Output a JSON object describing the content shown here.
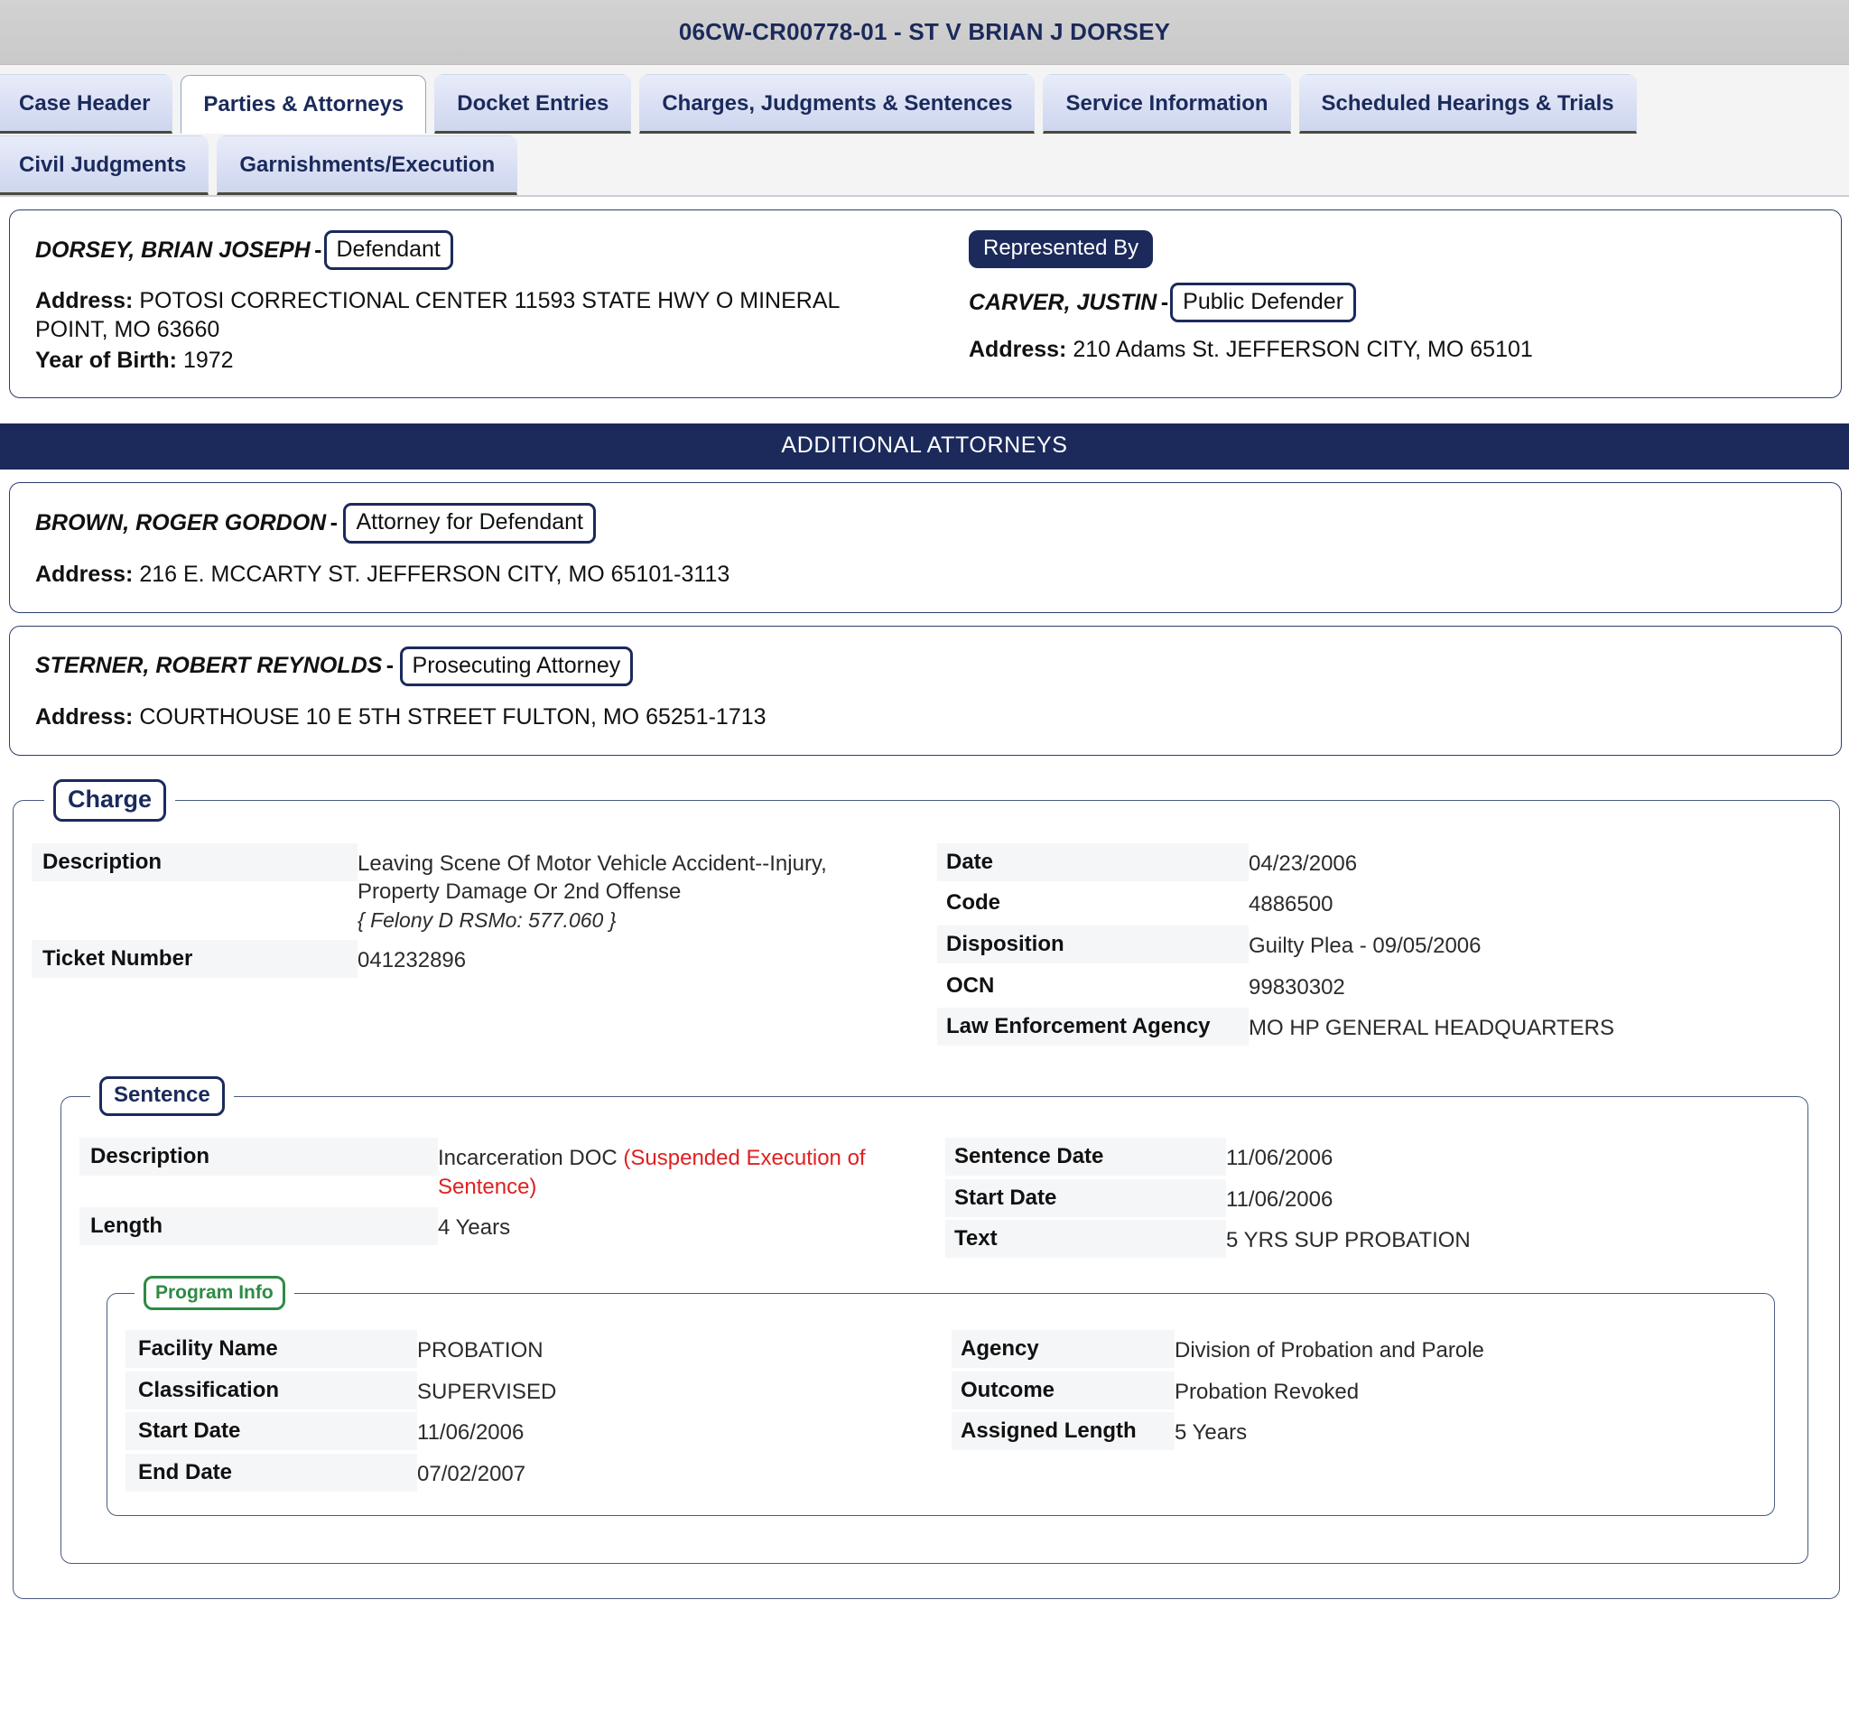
{
  "window": {
    "title": "06CW-CR00778-01 - ST V BRIAN J DORSEY"
  },
  "tabs": {
    "row1": [
      {
        "label": "Case Header",
        "active": false
      },
      {
        "label": "Parties & Attorneys",
        "active": true
      },
      {
        "label": "Docket Entries",
        "active": false
      },
      {
        "label": "Charges, Judgments & Sentences",
        "active": false
      },
      {
        "label": "Service Information",
        "active": false
      },
      {
        "label": "Scheduled Hearings & Trials",
        "active": false
      }
    ],
    "row2": [
      {
        "label": "Civil Judgments",
        "active": false
      },
      {
        "label": "Garnishments/Execution",
        "active": false
      }
    ]
  },
  "defendant": {
    "name": "DORSEY, BRIAN JOSEPH",
    "separator": "-",
    "role": "Defendant",
    "address_label": "Address:",
    "address": "POTOSI CORRECTIONAL CENTER 11593 STATE HWY O MINERAL POINT, MO 63660",
    "yob_label": "Year of Birth:",
    "yob": "1972"
  },
  "represented_by": {
    "badge": "Represented By",
    "name": "CARVER, JUSTIN",
    "separator": "-",
    "role": "Public Defender",
    "address_label": "Address:",
    "address": "210 Adams St. JEFFERSON CITY, MO 65101"
  },
  "additional_attorneys": {
    "banner": "ADDITIONAL ATTORNEYS",
    "entries": [
      {
        "name": "BROWN, ROGER GORDON",
        "separator": "-",
        "role": "Attorney for Defendant",
        "address_label": "Address:",
        "address": "216 E. MCCARTY ST. JEFFERSON CITY, MO 65101-3113"
      },
      {
        "name": "STERNER, ROBERT REYNOLDS",
        "separator": "-",
        "role": "Prosecuting Attorney",
        "address_label": "Address:",
        "address": "COURTHOUSE 10 E 5TH STREET FULTON, MO 65251-1713"
      }
    ]
  },
  "charge": {
    "legend": "Charge",
    "left": [
      {
        "label": "Description",
        "value": "Leaving Scene Of Motor Vehicle Accident--Injury, Property Damage Or 2nd Offense",
        "statute": "{ Felony D RSMo: 577.060 }"
      },
      {
        "label": "Ticket Number",
        "value": "041232896"
      }
    ],
    "right": [
      {
        "label": "Date",
        "value": "04/23/2006"
      },
      {
        "label": "Code",
        "value": "4886500"
      },
      {
        "label": "Disposition",
        "value": "Guilty Plea - 09/05/2006"
      },
      {
        "label": "OCN",
        "value": "99830302"
      },
      {
        "label": "Law Enforcement Agency",
        "value": "MO HP GENERAL HEADQUARTERS"
      }
    ]
  },
  "sentence": {
    "legend": "Sentence",
    "description_label": "Description",
    "description_main": "Incarceration DOC ",
    "description_red": "(Suspended Execution of Sentence)",
    "left": [
      {
        "label": "Length",
        "value": "4 Years"
      }
    ],
    "right": [
      {
        "label": "Sentence Date",
        "value": "11/06/2006"
      },
      {
        "label": "Start Date",
        "value": "11/06/2006"
      },
      {
        "label": "Text",
        "value": "5 YRS SUP PROBATION"
      }
    ]
  },
  "program_info": {
    "legend": "Program Info",
    "left": [
      {
        "label": "Facility Name",
        "value": "PROBATION"
      },
      {
        "label": "Classification",
        "value": "SUPERVISED"
      },
      {
        "label": "Start Date",
        "value": "11/06/2006"
      },
      {
        "label": "End Date",
        "value": "07/02/2007"
      }
    ],
    "right": [
      {
        "label": "Agency",
        "value": "Division of Probation and Parole"
      },
      {
        "label": "Outcome",
        "value": "Probation Revoked"
      },
      {
        "label": "Assigned Length",
        "value": "5 Years"
      }
    ]
  },
  "colors": {
    "navy": "#1b2a5b",
    "banner_bg": "#1b2a5b",
    "green": "#2e8b45",
    "red": "#e02020",
    "titlebar_bg": "#cdcdcd"
  }
}
